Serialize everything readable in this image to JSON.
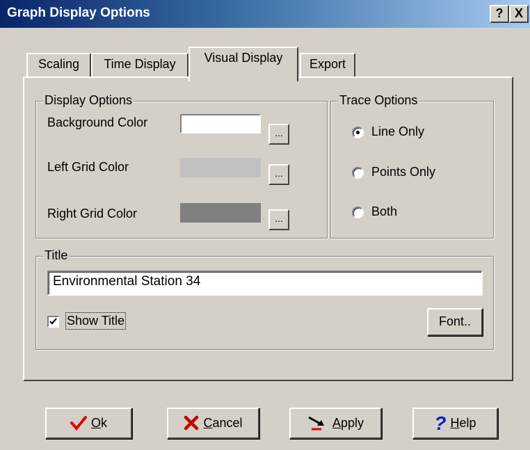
{
  "window": {
    "title": "Graph Display Options",
    "help_button": "?",
    "close_button": "X"
  },
  "tabs": [
    {
      "label": "Scaling",
      "active": false
    },
    {
      "label": "Time Display",
      "active": false
    },
    {
      "label": "Visual Display",
      "active": true
    },
    {
      "label": "Export",
      "active": false
    }
  ],
  "display_options": {
    "legend": "Display Options",
    "rows": [
      {
        "label": "Background Color",
        "color": "#ffffff",
        "button": "..."
      },
      {
        "label": "Left Grid Color",
        "color": "#c0c0c0",
        "button": "..."
      },
      {
        "label": "Right Grid Color",
        "color": "#808080",
        "button": "..."
      }
    ]
  },
  "trace_options": {
    "legend": "Trace Options",
    "options": [
      {
        "label": "Line Only",
        "selected": true
      },
      {
        "label": "Points Only",
        "selected": false
      },
      {
        "label": "Both",
        "selected": false
      }
    ]
  },
  "title_group": {
    "legend": "Title",
    "value": "Environmental Station 34",
    "show_title_label": "Show Title",
    "show_title_checked": true,
    "font_button": "Font.."
  },
  "buttons": {
    "ok": {
      "label_u": "O",
      "label_rest": "k",
      "icon": "check-icon"
    },
    "cancel": {
      "label_u": "C",
      "label_rest": "ancel",
      "icon": "x-icon"
    },
    "apply": {
      "label_u": "A",
      "label_rest": "pply",
      "icon": "apply-arrow-icon"
    },
    "help": {
      "label_u": "H",
      "label_rest": "elp",
      "icon": "question-icon"
    }
  },
  "colors": {
    "titlebar_start": "#0a246a",
    "titlebar_end": "#a6caf0",
    "ok_check": "#e00000",
    "cancel_x": "#c00000",
    "help_question": "#0020c0"
  }
}
